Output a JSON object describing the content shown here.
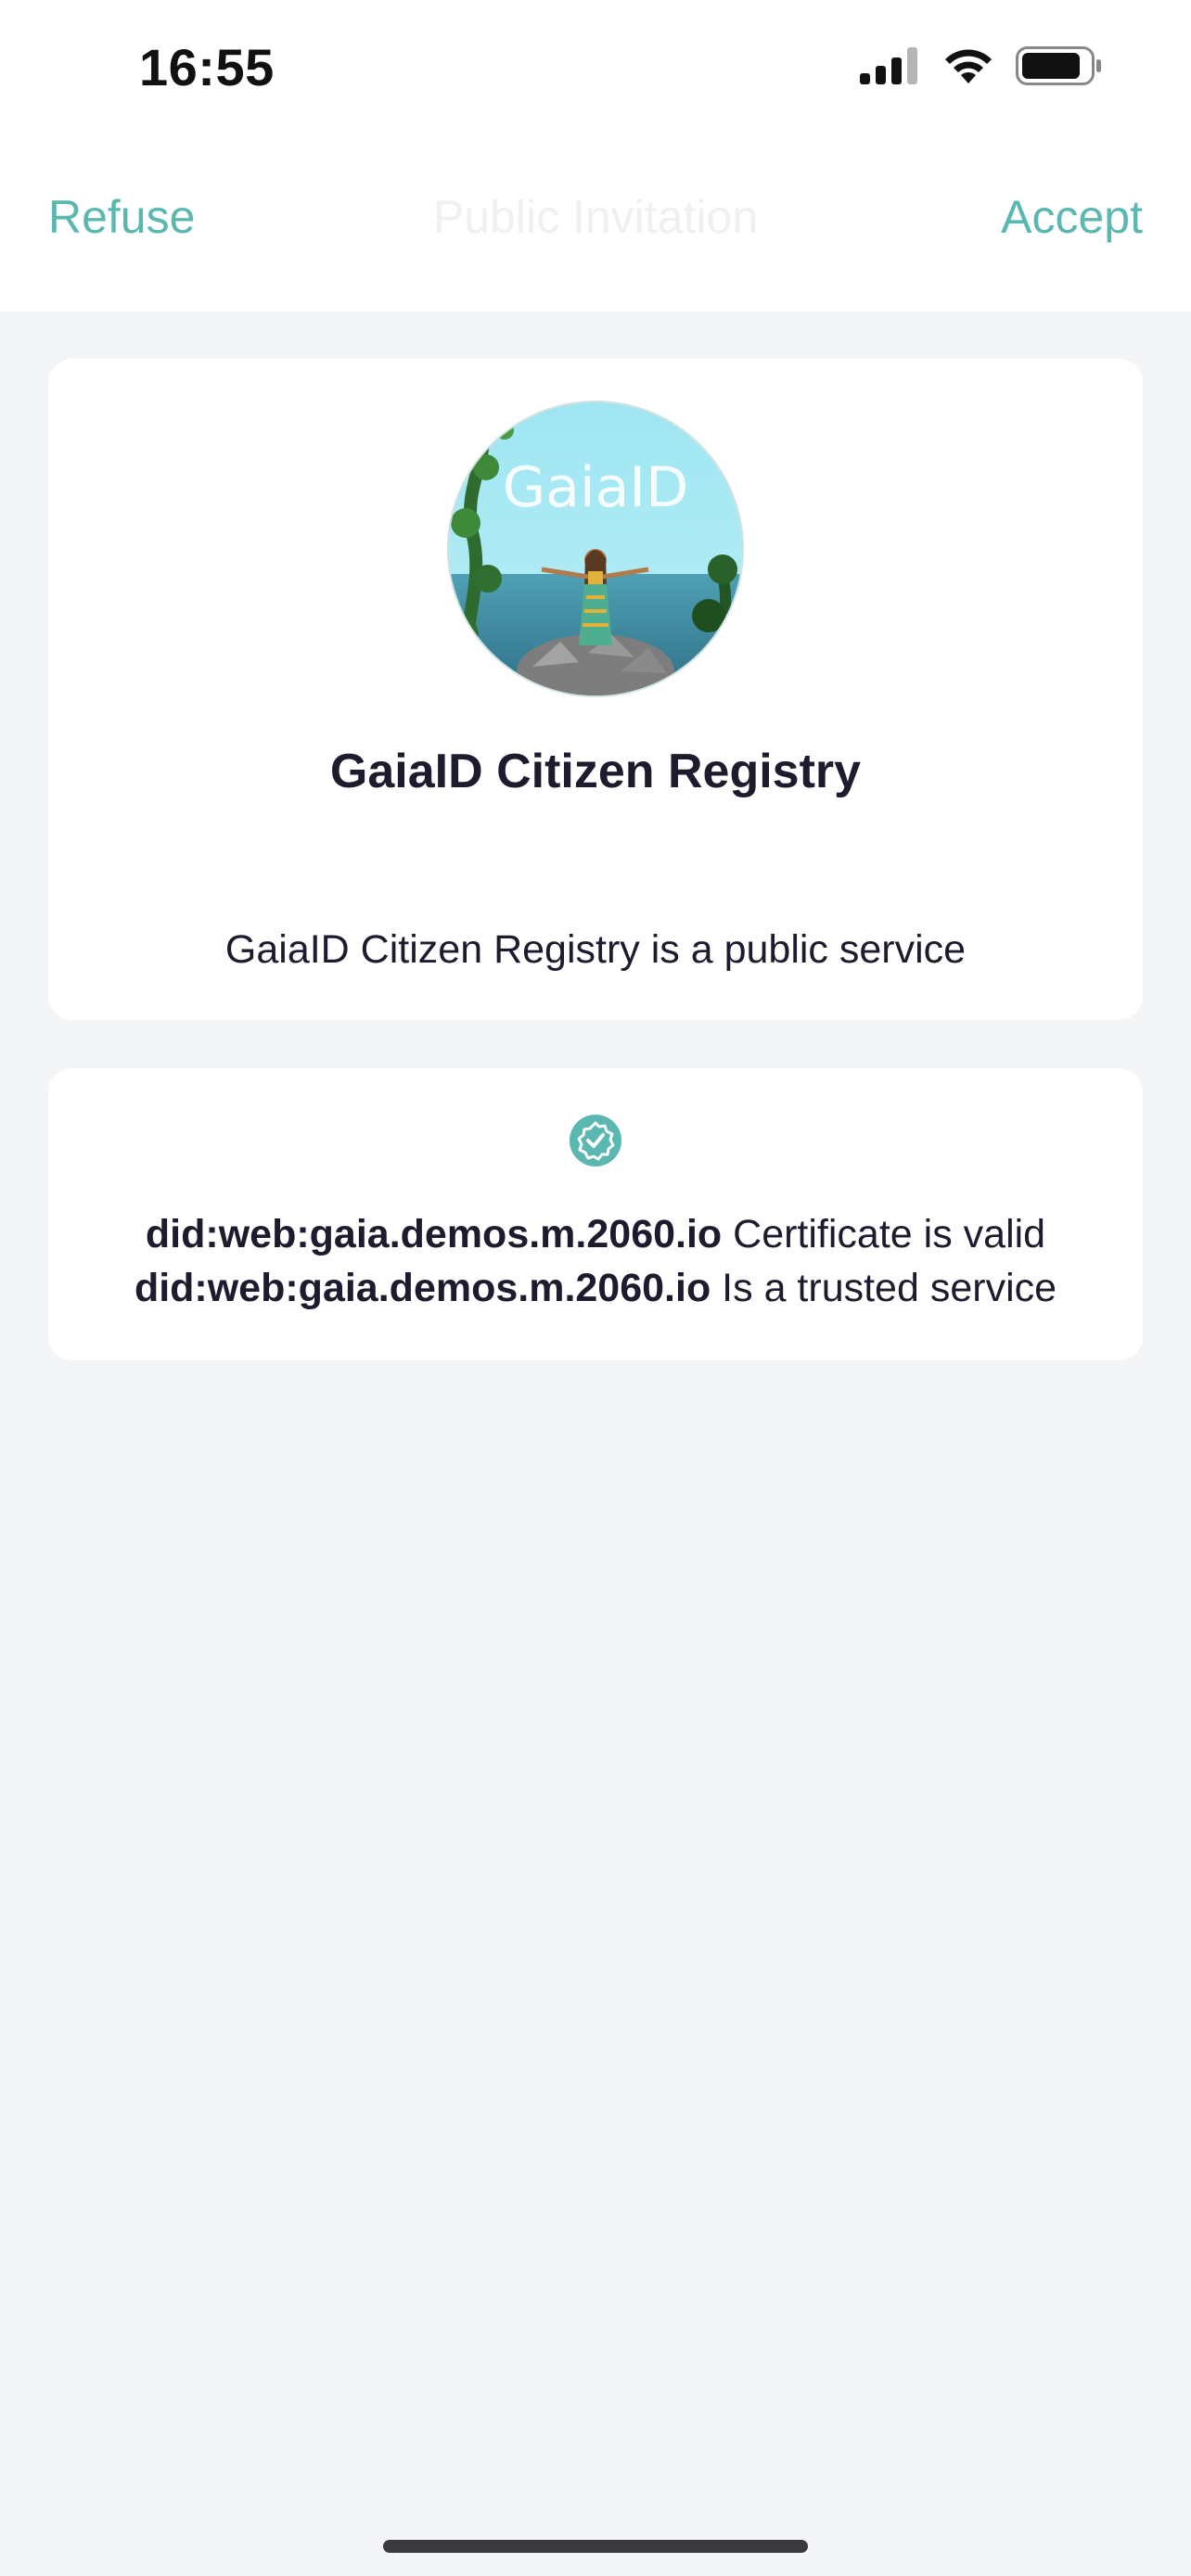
{
  "status_bar": {
    "time": "16:55"
  },
  "nav": {
    "left_label": "Refuse",
    "title": "Public Invitation",
    "right_label": "Accept"
  },
  "service": {
    "logo_text": "GaiaID",
    "name": "GaiaID Citizen Registry",
    "description": "GaiaID Citizen Registry is a public service"
  },
  "trust": {
    "icon": "verified-badge-icon",
    "lines": [
      {
        "did": "did:web:gaia.demos.m.2060.io",
        "text": "Certificate is valid"
      },
      {
        "did": "did:web:gaia.demos.m.2060.io",
        "text": "Is a trusted service"
      }
    ]
  },
  "colors": {
    "accent": "#5ab8b0",
    "background": "#f4f5f7",
    "card": "#ffffff",
    "text": "#1c1c2e"
  }
}
